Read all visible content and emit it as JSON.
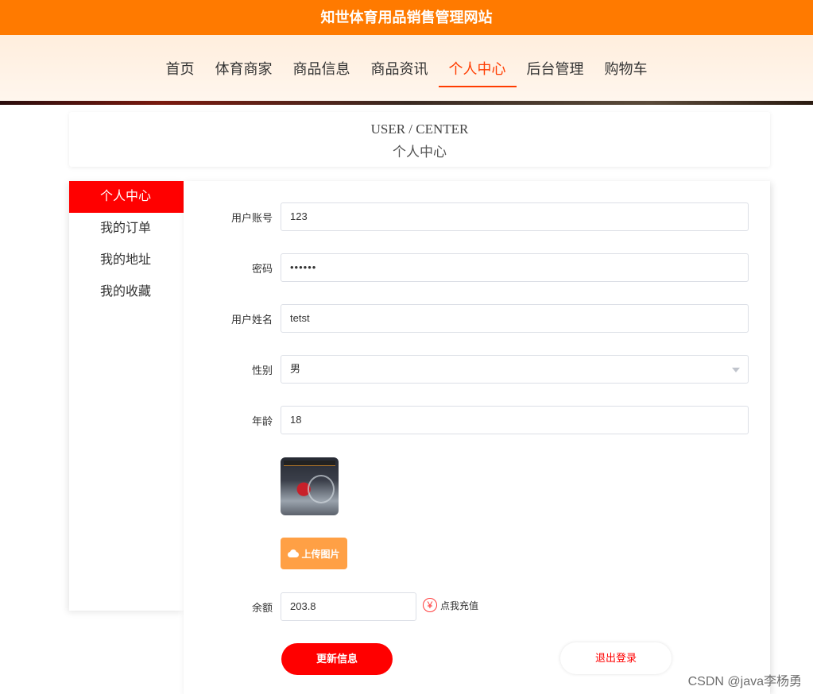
{
  "site": {
    "title": "知世体育用品销售管理网站"
  },
  "nav": {
    "items": [
      "首页",
      "体育商家",
      "商品信息",
      "商品资讯",
      "个人中心",
      "后台管理",
      "购物车"
    ],
    "active_index": 4
  },
  "center_header": {
    "en": "USER / CENTER",
    "zh": "个人中心"
  },
  "sidebar": {
    "items": [
      "个人中心",
      "我的订单",
      "我的地址",
      "我的收藏"
    ],
    "active_index": 0
  },
  "form": {
    "account": {
      "label": "用户账号",
      "value": "123"
    },
    "password": {
      "label": "密码",
      "value": "••••••"
    },
    "name": {
      "label": "用户姓名",
      "value": "tetst"
    },
    "gender": {
      "label": "性别",
      "value": "男"
    },
    "age": {
      "label": "年龄",
      "value": "18"
    },
    "upload_label": "上传图片",
    "balance": {
      "label": "余额",
      "value": "203.8"
    },
    "recharge_label": "点我充值",
    "yen_symbol": "¥"
  },
  "buttons": {
    "update": "更新信息",
    "logout": "退出登录"
  },
  "watermark": "CSDN @java李杨勇",
  "colors": {
    "topbar": "#ff7a00",
    "accent": "#ff0000",
    "upload": "#ffa045"
  }
}
